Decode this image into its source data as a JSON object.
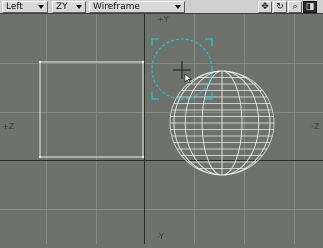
{
  "toolbar": {
    "view_dropdown": "Left",
    "axis_dropdown": "ZY",
    "render_mode_dropdown": "Wireframe",
    "buttons": [
      {
        "name": "move-view-button",
        "glyph": "✥"
      },
      {
        "name": "rotate-view-button",
        "glyph": "↻"
      },
      {
        "name": "zoom-view-button",
        "glyph": "⌕"
      },
      {
        "name": "maximize-view-button",
        "glyph": "◨"
      }
    ]
  },
  "viewport": {
    "axis_labels": {
      "top": "+Y",
      "left": "+Z",
      "right": "-Z",
      "bottom": "-Y"
    }
  },
  "colors": {
    "background": "#6e716c",
    "grid_major": "#2a2b29",
    "grid_minor": "#868985",
    "wireframe": "#ececec",
    "selection": "#1ec8c8"
  }
}
